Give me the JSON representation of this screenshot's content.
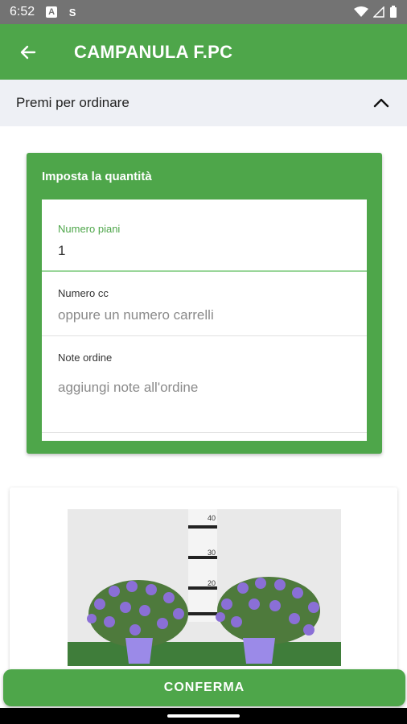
{
  "status": {
    "time": "6:52"
  },
  "appbar": {
    "title": "CAMPANULA F.PC",
    "back_icon": "arrow-left-icon"
  },
  "order_section": {
    "label": "Premi per ordinare",
    "chevron_icon": "chevron-up-icon"
  },
  "quantity_card": {
    "title": "Imposta la quantità",
    "fields": [
      {
        "label": "Numero piani",
        "value": "1",
        "placeholder": ""
      },
      {
        "label": "Numero cc",
        "value": "",
        "placeholder": "oppure un numero carrelli"
      },
      {
        "label": "Note ordine",
        "value": "",
        "placeholder": "aggiungi note all'ordine"
      }
    ]
  },
  "product_photo": {
    "ruler_marks": [
      "40",
      "30",
      "20"
    ]
  },
  "confirm_button": {
    "label": "CONFERMA"
  },
  "colors": {
    "accent": "#4ea64a",
    "statusbar": "#737373",
    "section_bg": "#eef0f5"
  }
}
